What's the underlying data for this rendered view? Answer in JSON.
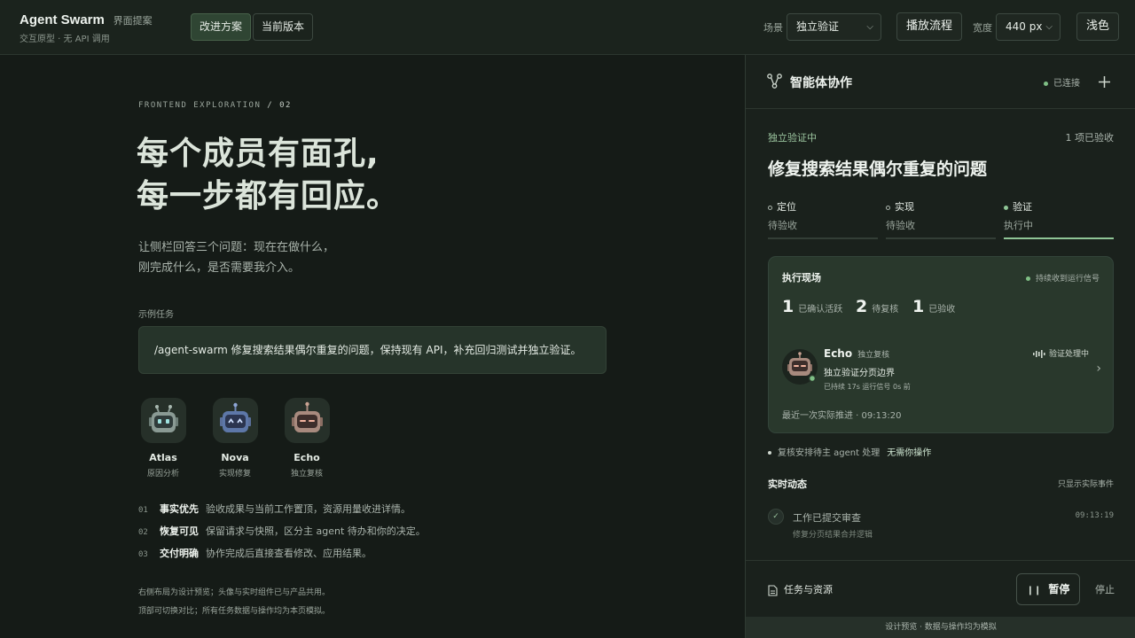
{
  "topbar": {
    "app_title": "Agent Swarm",
    "app_subtitle": "界面提案",
    "app_desc": "交互原型 · 无 API 调用",
    "view_tabs": [
      {
        "label": "改进方案"
      },
      {
        "label": "当前版本"
      }
    ],
    "scene_label": "场景",
    "scene_value": "独立验证",
    "play_label": "播放流程",
    "width_label": "宽度",
    "width_value": "440 px",
    "theme_label": "浅色"
  },
  "left": {
    "kicker_a": "FRONTEND EXPLORATION",
    "kicker_b": "/ 02",
    "hero_line1": "每个成员有面孔,",
    "hero_line2": "每一步都有回应。",
    "lead_line1": "让侧栏回答三个问题：现在在做什么，",
    "lead_line2": "刚完成什么，是否需要我介入。",
    "example_label": "示例任务",
    "example_text": "/agent-swarm 修复搜索结果偶尔重复的问题，保持现有 API，补充回归测试并独立验证。",
    "agents": [
      {
        "name": "Atlas",
        "role": "原因分析"
      },
      {
        "name": "Nova",
        "role": "实现修复"
      },
      {
        "name": "Echo",
        "role": "独立复核"
      }
    ],
    "points": [
      {
        "num": "01",
        "title": "事实优先",
        "text": "验收成果与当前工作置顶，资源用量收进详情。"
      },
      {
        "num": "02",
        "title": "恢复可见",
        "text": "保留请求与快照，区分主 agent 待办和你的决定。"
      },
      {
        "num": "03",
        "title": "交付明确",
        "text": "协作完成后直接查看修改、应用结果。"
      }
    ],
    "footnote1": "右侧布局为设计预览；头像与实时组件已与产品共用。",
    "footnote2": "顶部可切换对比；所有任务数据与操作均为本页模拟。"
  },
  "panel": {
    "title": "智能体协作",
    "connection": "已连接",
    "status": "独立验证中",
    "accepted_count": "1 项已验收",
    "task_title": "修复搜索结果偶尔重复的问题",
    "steps": [
      {
        "name": "定位",
        "state": "待验收"
      },
      {
        "name": "实现",
        "state": "待验收"
      },
      {
        "name": "验证",
        "state": "执行中"
      }
    ],
    "live": {
      "title": "执行现场",
      "signal": "持续收到运行信号",
      "stats": [
        {
          "n": "1",
          "label": "已确认活跃"
        },
        {
          "n": "2",
          "label": "待复核"
        },
        {
          "n": "1",
          "label": "已验收"
        }
      ],
      "agent_name": "Echo",
      "agent_role": "独立复核",
      "agent_task": "独立验证分页边界",
      "agent_meta": "已持续 17s   运行信号 0s 前",
      "processing": "验证处理中",
      "last_progress": "最近一次实际推进 · 09:13:20"
    },
    "note_text": "复核安排待主 agent 处理",
    "note_action": "无需你操作",
    "feed_title": "实时动态",
    "feed_filter": "只显示实际事件",
    "events": [
      {
        "title": "工作已提交审查",
        "sub": "修复分页结果合并逻辑",
        "time": "09:13:19"
      }
    ],
    "resources_label": "任务与资源",
    "pause_label": "暂停",
    "stop_label": "停止",
    "bottom_note": "设计预览 · 数据与操作均为模拟"
  },
  "colors": {
    "accent": "#8fc596",
    "card": "#29382c",
    "background": "#151b17"
  }
}
